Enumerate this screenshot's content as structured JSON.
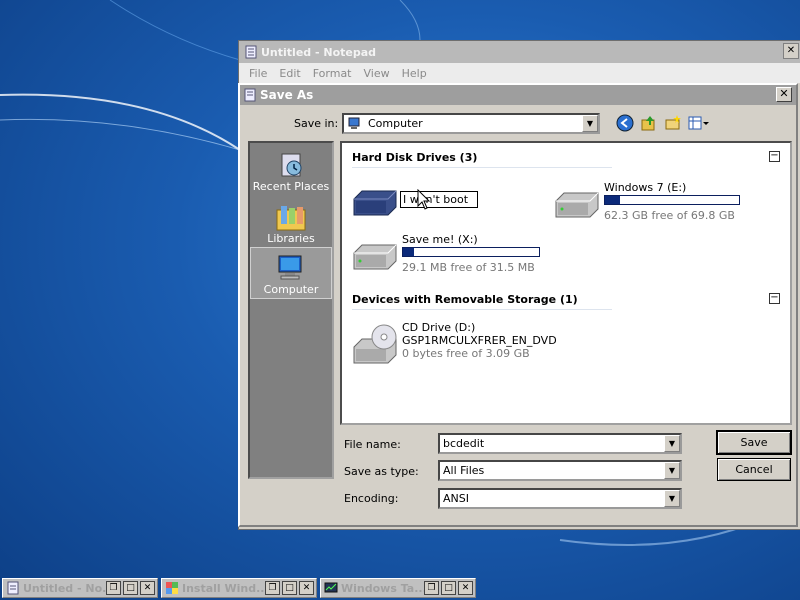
{
  "notepad": {
    "title": "Untitled - Notepad",
    "menu": [
      "File",
      "Edit",
      "Format",
      "View",
      "Help"
    ]
  },
  "dialog": {
    "title": "Save As",
    "save_in_label": "Save in:",
    "save_in_value": "Computer",
    "places": [
      {
        "label": "Recent Places",
        "icon": "recent-places-icon"
      },
      {
        "label": "Libraries",
        "icon": "libraries-icon"
      },
      {
        "label": "Computer",
        "icon": "computer-icon",
        "active": true
      }
    ],
    "groups": {
      "hdd": {
        "header": "Hard Disk Drives (3)",
        "drives": [
          {
            "rename_value": "I won't boot",
            "icon": "hard-drive-icon"
          },
          {
            "name": "Windows 7 (E:)",
            "free": "62.3 GB free of 69.8 GB",
            "used_fraction": 0.11,
            "icon": "hard-drive-icon"
          },
          {
            "name": "Save me! (X:)",
            "free": "29.1 MB free of 31.5 MB",
            "used_fraction": 0.08,
            "icon": "hard-drive-icon"
          }
        ]
      },
      "removable": {
        "header": "Devices with Removable Storage (1)",
        "drives": [
          {
            "name": "CD Drive (D:)",
            "label": "GSP1RMCULXFRER_EN_DVD",
            "free": "0 bytes free of 3.09 GB",
            "icon": "cd-drive-icon"
          }
        ]
      }
    },
    "file_name_label": "File name:",
    "file_name_value": "bcdedit",
    "save_type_label": "Save as type:",
    "save_type_value": "All Files",
    "encoding_label": "Encoding:",
    "encoding_value": "ANSI",
    "save_button": "Save",
    "cancel_button": "Cancel",
    "collapse_symbol": "−"
  },
  "taskbar": [
    {
      "label": "Untitled - No...",
      "icon": "notepad-icon"
    },
    {
      "label": "Install Wind...",
      "icon": "installer-icon"
    },
    {
      "label": "Windows Ta...",
      "icon": "task-manager-icon"
    }
  ]
}
